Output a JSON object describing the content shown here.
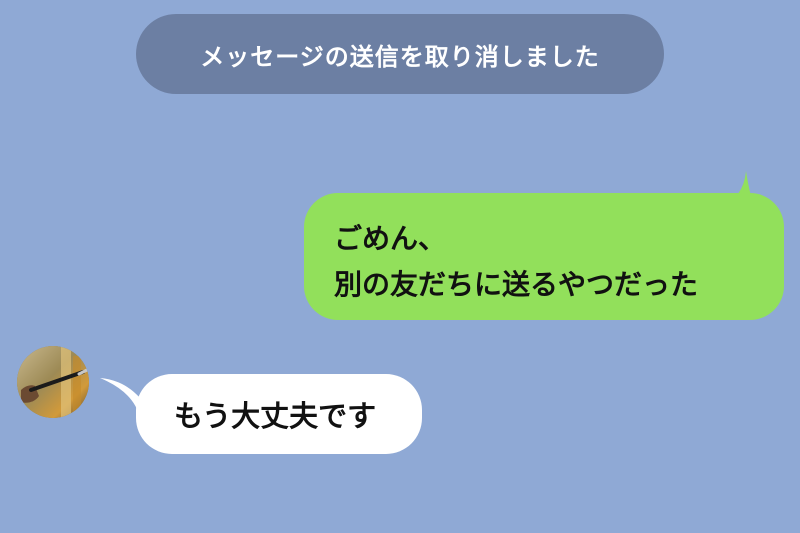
{
  "system_message": {
    "text": "メッセージの送信を取り消しました"
  },
  "outgoing_message": {
    "lines": [
      "ごめん、",
      "別の友だちに送るやつだった"
    ],
    "bubble_color": "#92e05b"
  },
  "incoming_message": {
    "text": "もう大丈夫です",
    "bubble_color": "#ffffff"
  },
  "colors": {
    "background": "#8fa9d5",
    "system_pill": "#6c7fa3"
  }
}
